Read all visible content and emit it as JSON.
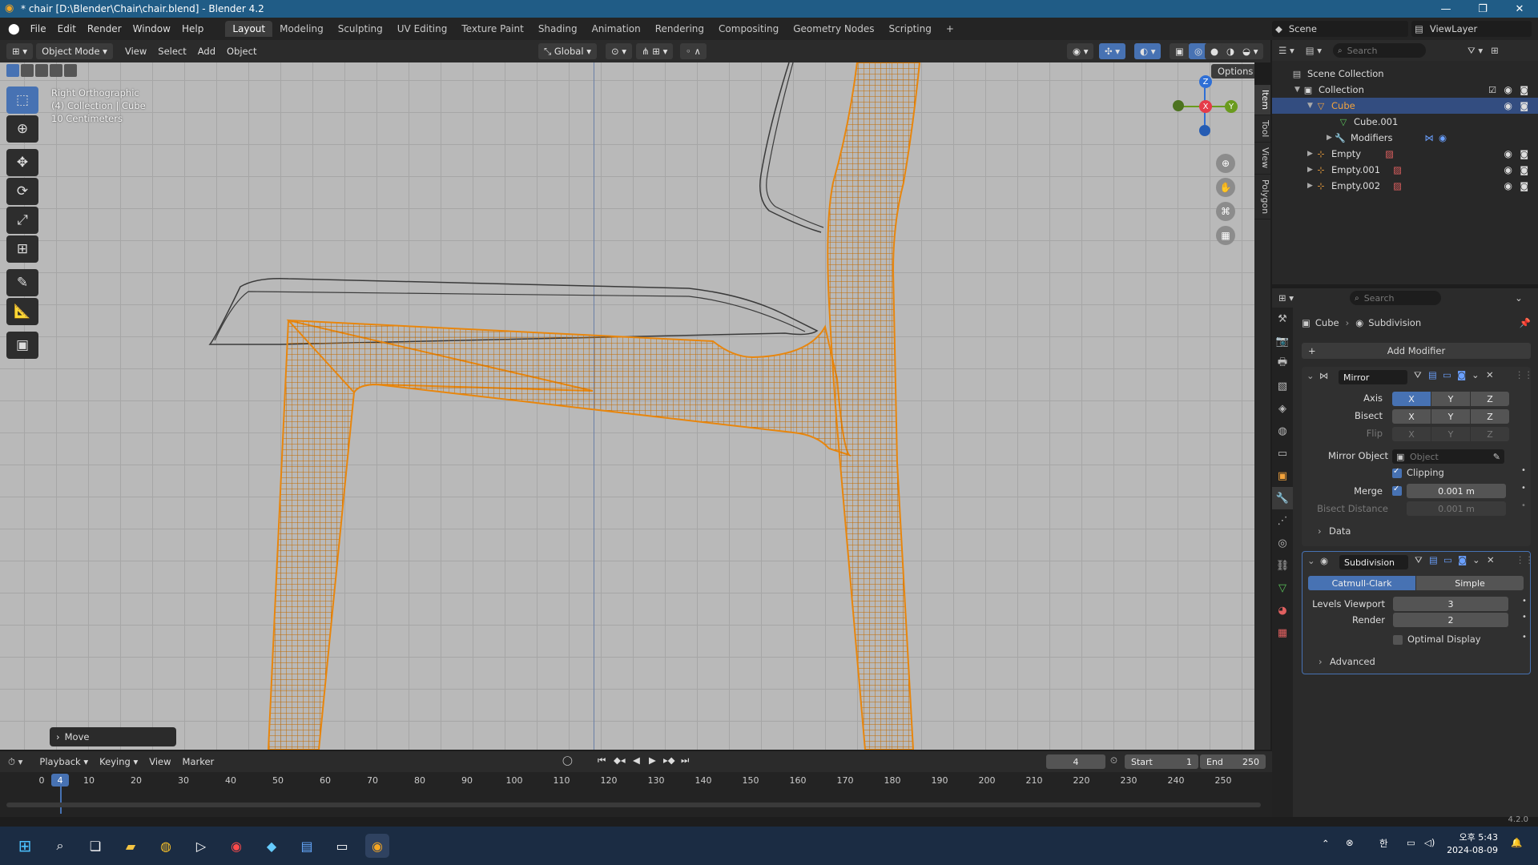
{
  "window": {
    "title": "* chair [D:\\Blender\\Chair\\chair.blend] - Blender 4.2"
  },
  "menu": [
    "File",
    "Edit",
    "Render",
    "Window",
    "Help"
  ],
  "workspaces": [
    "Layout",
    "Modeling",
    "Sculpting",
    "UV Editing",
    "Texture Paint",
    "Shading",
    "Animation",
    "Rendering",
    "Compositing",
    "Geometry Nodes",
    "Scripting"
  ],
  "scene": {
    "name": "Scene",
    "view_layer": "ViewLayer"
  },
  "viewport_header": {
    "mode": "Object Mode",
    "menus": [
      "View",
      "Select",
      "Add",
      "Object"
    ],
    "orientation": "Global",
    "options": "Options"
  },
  "viewport_overlay": {
    "line1": "Right Orthographic",
    "line2": "(4) Collection | Cube",
    "line3": "10 Centimeters"
  },
  "gizmo": {
    "x": "X",
    "y": "Y",
    "z": "Z"
  },
  "sidebar_tabs": [
    "Item",
    "Tool",
    "View",
    "Polygon"
  ],
  "last_op": "Move",
  "outliner": {
    "search_placeholder": "Search",
    "rows": [
      "Scene Collection",
      "Collection",
      "Cube",
      "Cube.001",
      "Modifiers",
      "Empty",
      "Empty.001",
      "Empty.002"
    ]
  },
  "properties": {
    "search_placeholder": "Search",
    "breadcrumb_object": "Cube",
    "breadcrumb_modifier": "Subdivision",
    "add_modifier": "Add Modifier",
    "mirror": {
      "name": "Mirror",
      "axis_label": "Axis",
      "bisect_label": "Bisect",
      "flip_label": "Flip",
      "axes": [
        "X",
        "Y",
        "Z"
      ],
      "mirror_object_label": "Mirror Object",
      "mirror_object_placeholder": "Object",
      "clipping_label": "Clipping",
      "merge_label": "Merge",
      "merge_value": "0.001 m",
      "bisect_distance_label": "Bisect Distance",
      "bisect_distance_value": "0.001 m",
      "data_label": "Data"
    },
    "subdivision": {
      "name": "Subdivision",
      "catmull": "Catmull-Clark",
      "simple": "Simple",
      "levels_viewport_label": "Levels Viewport",
      "levels_viewport_value": "3",
      "render_label": "Render",
      "render_value": "2",
      "optimal_label": "Optimal Display",
      "advanced_label": "Advanced"
    }
  },
  "timeline": {
    "menus": [
      "Playback",
      "Keying",
      "View",
      "Marker"
    ],
    "current_frame": "4",
    "start_label": "Start",
    "start_value": "1",
    "end_label": "End",
    "end_value": "250",
    "ruler": [
      "0",
      "10",
      "20",
      "30",
      "40",
      "50",
      "60",
      "70",
      "80",
      "90",
      "100",
      "110",
      "120",
      "130",
      "140",
      "150",
      "160",
      "170",
      "180",
      "190",
      "200",
      "210",
      "220",
      "230",
      "240",
      "250"
    ]
  },
  "status": {
    "version": "4.2.0"
  },
  "taskbar": {
    "time": "오후 5:43",
    "date": "2024-08-09",
    "ime": "한"
  }
}
